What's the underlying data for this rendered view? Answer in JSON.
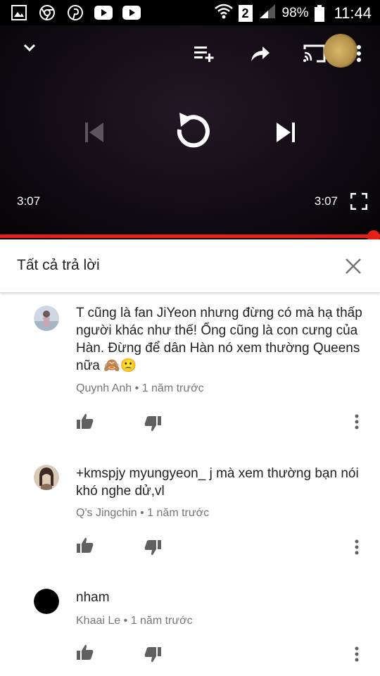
{
  "status_bar": {
    "battery": "98%",
    "time": "11:44",
    "sim": "2",
    "left_icons": [
      "gallery-icon",
      "chrome-icon",
      "pinterest-icon",
      "youtube-icon",
      "youtube-icon"
    ]
  },
  "player": {
    "current_time": "3:07",
    "duration": "3:07",
    "progress": 1.0,
    "accent_color": "#e62117"
  },
  "replies": {
    "title": "Tất cả trả lời"
  },
  "comments": [
    {
      "text": "T cũng là fan JiYeon nhưng đừng có mà hạ thấp người khác như thế! Ổng cũng là con cưng của Hàn. Đừng để dân Hàn nó xem thường Queens nữa 🙈🙁",
      "author": "Quynh Anh",
      "time": "1 năm trước"
    },
    {
      "text": "+kmspjy myungyeon_ j mà xem thường bạn nói khó nghe dử,vl",
      "author": "Q's Jingchin",
      "time": "1 năm trước"
    },
    {
      "text": "nham",
      "author": "Khaai Le",
      "time": "1 năm trước"
    }
  ],
  "meta_separator": "•"
}
